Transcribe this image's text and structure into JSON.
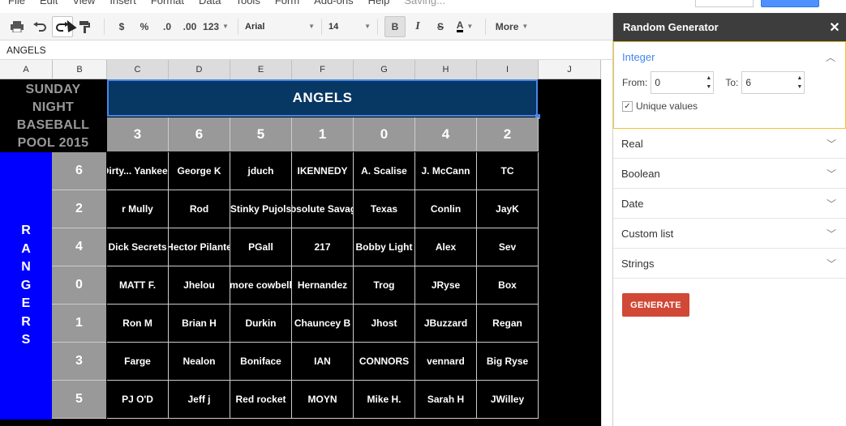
{
  "menu": [
    "File",
    "Edit",
    "View",
    "Insert",
    "Format",
    "Data",
    "Tools",
    "Form",
    "Add-ons",
    "Help"
  ],
  "menu_status": "Saving...",
  "toolbar": {
    "currency": "$",
    "percent": "%",
    "dec_less": ".0",
    "dec_more": ".00",
    "format_more": "123",
    "font": "Arial",
    "size": "14",
    "bold": "B",
    "italic": "I",
    "strike": "S",
    "textcolor": "A",
    "more": "More"
  },
  "formula_bar": "ANGELS",
  "columns": [
    "A",
    "B",
    "C",
    "D",
    "E",
    "F",
    "G",
    "H",
    "I",
    "J"
  ],
  "sheet": {
    "title_lines": [
      "SUNDAY",
      "NIGHT",
      "BASEBALL",
      "POOL 2015"
    ],
    "team_top": "ANGELS",
    "team_side_letters": [
      "R",
      "A",
      "N",
      "G",
      "E",
      "R",
      "S"
    ],
    "top_numbers": [
      "3",
      "6",
      "5",
      "1",
      "0",
      "4",
      "2"
    ],
    "side_numbers": [
      "6",
      "2",
      "4",
      "0",
      "1",
      "3",
      "5"
    ],
    "rows": [
      [
        "Dirty... Yankees",
        "George K",
        "jduch",
        "IKENNEDY",
        "A. Scalise",
        "J. McCann",
        "TC"
      ],
      [
        "r Mully",
        "Rod",
        "Stinky Pujols",
        "Absolute Savage",
        "Texas",
        "Conlin",
        "JayK"
      ],
      [
        "Dick Secrets",
        "Hector Pilante",
        "PGall",
        "217",
        "Bobby Light",
        "Alex",
        "Sev"
      ],
      [
        "MATT F.",
        "Jhelou",
        "more cowbell",
        "Hernandez",
        "Trog",
        "JRyse",
        "Box"
      ],
      [
        "Ron M",
        "Brian H",
        "Durkin",
        "Chauncey B",
        "Jhost",
        "JBuzzard",
        "Regan"
      ],
      [
        "Farge",
        "Nealon",
        "Boniface",
        "IAN",
        "CONNORS",
        "vennard",
        "Big Ryse"
      ],
      [
        "PJ O'D",
        "Jeff j",
        "Red rocket",
        "MOYN",
        "Mike H.",
        "Sarah H",
        "JWilley"
      ]
    ]
  },
  "sidebar": {
    "title": "Random Generator",
    "integer": {
      "label": "Integer",
      "from_label": "From:",
      "from_value": "0",
      "to_label": "To:",
      "to_value": "6",
      "unique_label": "Unique values",
      "unique_checked": true
    },
    "sections": [
      "Real",
      "Boolean",
      "Date",
      "Custom list",
      "Strings"
    ],
    "generate_label": "GENERATE"
  }
}
